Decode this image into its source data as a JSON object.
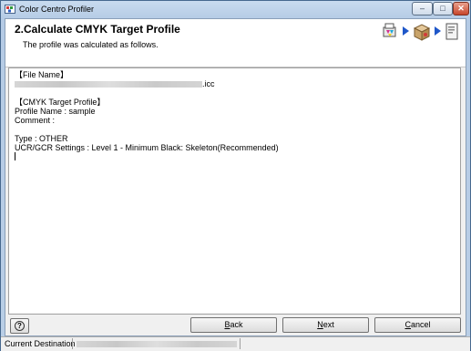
{
  "window": {
    "title": "Color Centro Profiler",
    "min_glyph": "–",
    "max_glyph": "□",
    "close_glyph": "✕"
  },
  "header": {
    "title": "2.Calculate CMYK Target Profile",
    "subtitle": "The profile was calculated as follows."
  },
  "content": {
    "file_name_heading": "【File Name】",
    "file_ext": ".icc",
    "profile_heading": "【CMYK Target Profile】",
    "profile_name": "Profile Name : sample",
    "comment": "Comment :",
    "type": "Type : OTHER",
    "ucr_gcr": "UCR/GCR Settings : Level 1 - Minimum Black: Skeleton(Recommended)"
  },
  "buttons": {
    "help": "?",
    "back_prefix": "",
    "back_mnemonic": "B",
    "back_rest": "ack",
    "next_prefix": "",
    "next_mnemonic": "N",
    "next_rest": "ext",
    "cancel_prefix": "",
    "cancel_mnemonic": "C",
    "cancel_rest": "ancel"
  },
  "status": {
    "label": "Current Destination"
  },
  "icons": [
    "app-icon",
    "printer-icon",
    "arrow-right-icon",
    "box-icon",
    "arrow-right-icon",
    "document-icon",
    "help-icon"
  ],
  "colors": {
    "title_bar": "#c9dbef",
    "header_bg": "#ffffff",
    "client_bg": "#f0f0f0",
    "arrow_blue": "#1f57c9"
  }
}
